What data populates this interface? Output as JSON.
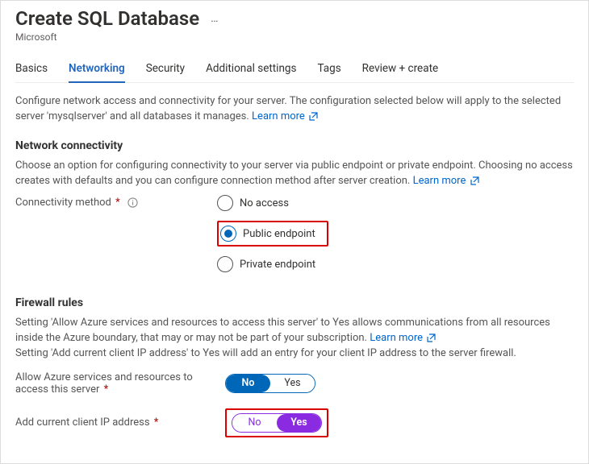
{
  "header": {
    "title": "Create SQL Database",
    "subtitle": "Microsoft",
    "ellipsis": "…"
  },
  "tabs": [
    {
      "label": "Basics",
      "active": false
    },
    {
      "label": "Networking",
      "active": true
    },
    {
      "label": "Security",
      "active": false
    },
    {
      "label": "Additional settings",
      "active": false
    },
    {
      "label": "Tags",
      "active": false
    },
    {
      "label": "Review + create",
      "active": false
    }
  ],
  "intro": {
    "text": "Configure network access and connectivity for your server. The configuration selected below will apply to the selected server 'mysqlserver' and all databases it manages.",
    "learn_more": "Learn more"
  },
  "sections": {
    "connectivity": {
      "title": "Network connectivity",
      "desc": "Choose an option for configuring connectivity to your server via public endpoint or private endpoint. Choosing no access creates with defaults and you can configure connection method after server creation.",
      "learn_more": "Learn more",
      "field_label": "Connectivity method",
      "options": [
        {
          "label": "No access",
          "selected": false,
          "highlight": false
        },
        {
          "label": "Public endpoint",
          "selected": true,
          "highlight": true
        },
        {
          "label": "Private endpoint",
          "selected": false,
          "highlight": false
        }
      ]
    },
    "firewall": {
      "title": "Firewall rules",
      "desc1": "Setting 'Allow Azure services and resources to access this server' to Yes allows communications from all resources inside the Azure boundary, that may or may not be part of your subscription.",
      "learn_more": "Learn more",
      "desc2": "Setting 'Add current client IP address' to Yes will add an entry for your client IP address to the server firewall.",
      "allow_azure": {
        "label": "Allow Azure services and resources to access this server",
        "no": "No",
        "yes": "Yes",
        "value": "No"
      },
      "add_ip": {
        "label": "Add current client IP address",
        "no": "No",
        "yes": "Yes",
        "value": "Yes"
      }
    }
  }
}
